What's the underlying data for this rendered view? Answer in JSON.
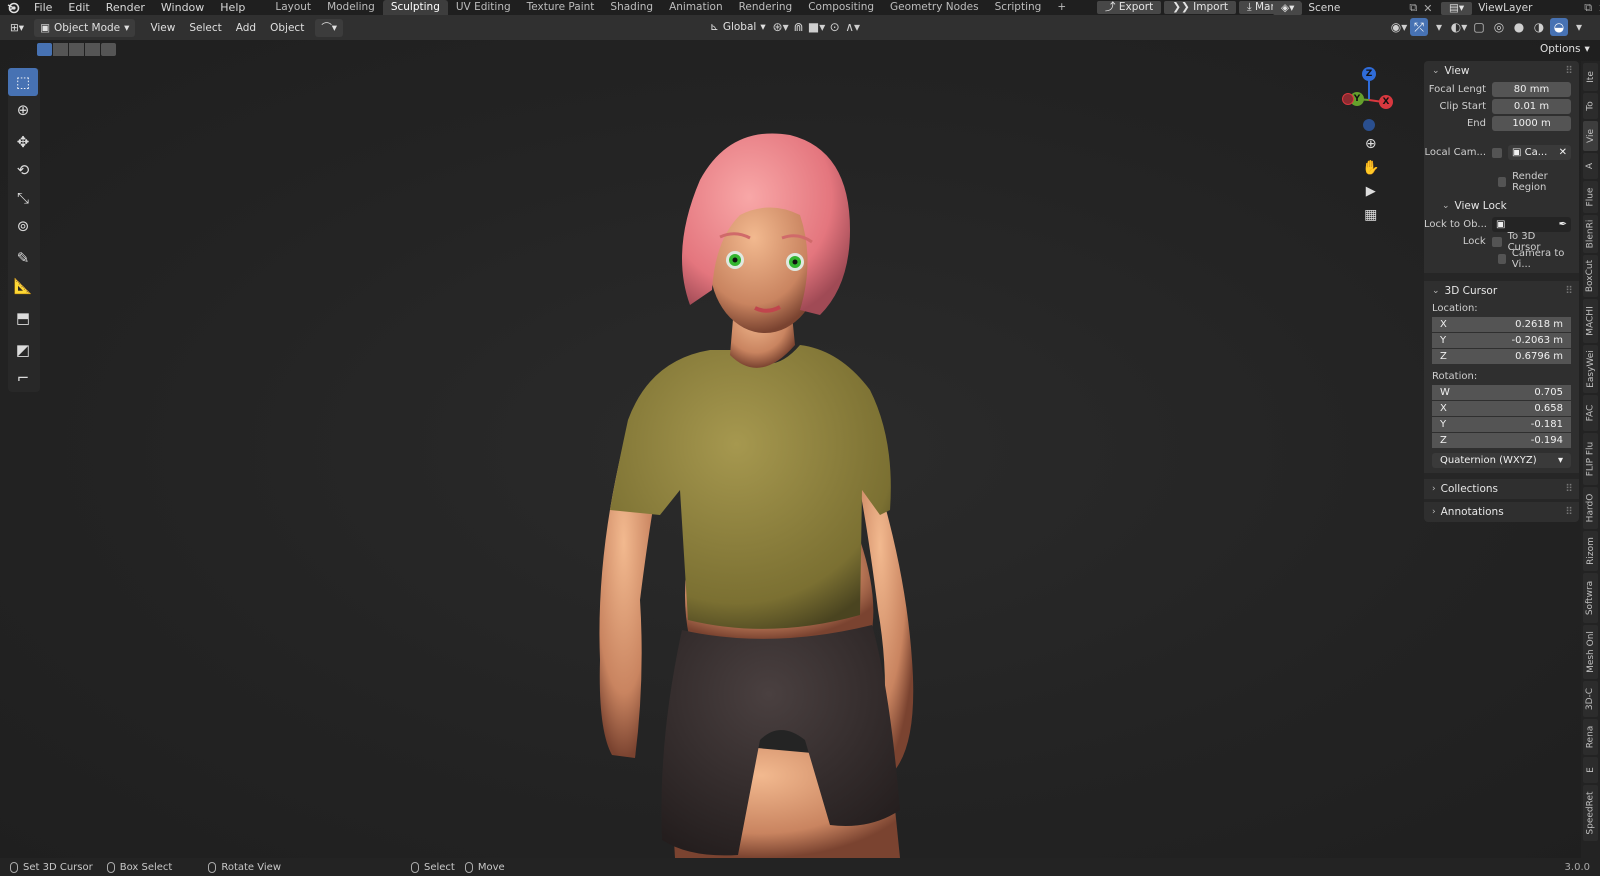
{
  "menubar": {
    "items": [
      "File",
      "Edit",
      "Render",
      "Window",
      "Help"
    ],
    "workspace_tabs": [
      "Layout",
      "Modeling",
      "Sculpting",
      "UV Editing",
      "Texture Paint",
      "Shading",
      "Animation",
      "Rendering",
      "Compositing",
      "Geometry Nodes",
      "Scripting"
    ],
    "active_tab": "Sculpting",
    "add_tab": "+",
    "export_label": "Export",
    "import_label": "Import",
    "manual_label": "Manual",
    "scene_label": "Scene",
    "viewlayer_label": "ViewLayer"
  },
  "header": {
    "mode": "Object Mode",
    "menus": [
      "View",
      "Select",
      "Add",
      "Object"
    ],
    "transform_orientation": "Global",
    "options_label": "Options"
  },
  "toolbar": {
    "tools": [
      "select-box-icon",
      "cursor-icon",
      "move-icon",
      "rotate-icon",
      "scale-icon",
      "transform-icon",
      "annotate-icon",
      "measure-icon",
      "add-cube-icon",
      "shear-icon",
      "bend-icon"
    ],
    "active": "select-box-icon"
  },
  "gizmo": {
    "z": "Z",
    "y": "Y",
    "x": "X"
  },
  "npanel": {
    "view": {
      "title": "View",
      "focal_length_label": "Focal Lengt",
      "focal_length": "80 mm",
      "clip_start_label": "Clip Start",
      "clip_start": "0.01 m",
      "end_label": "End",
      "end": "1000 m",
      "local_camera_label": "Local Cam...",
      "local_camera_value": "Ca...",
      "render_region_label": "Render Region",
      "view_lock_title": "View Lock",
      "lock_to_object_label": "Lock to Ob...",
      "lock_label": "Lock",
      "to_3d_cursor_label": "To 3D Cursor",
      "camera_to_view_label": "Camera to Vi..."
    },
    "cursor": {
      "title": "3D Cursor",
      "location_label": "Location:",
      "location": [
        {
          "axis": "X",
          "value": "0.2618 m"
        },
        {
          "axis": "Y",
          "value": "-0.2063 m"
        },
        {
          "axis": "Z",
          "value": "0.6796 m"
        }
      ],
      "rotation_label": "Rotation:",
      "rotation": [
        {
          "axis": "W",
          "value": "0.705"
        },
        {
          "axis": "X",
          "value": "0.658"
        },
        {
          "axis": "Y",
          "value": "-0.181"
        },
        {
          "axis": "Z",
          "value": "-0.194"
        }
      ],
      "rotation_mode": "Quaternion (WXYZ)"
    },
    "collections_title": "Collections",
    "annotations_title": "Annotations"
  },
  "side_tabs": [
    "Ite",
    "To",
    "Vie",
    "A",
    "Flue",
    "BlenRi",
    "BoxCut",
    "MACHI",
    "EasyWei",
    "FAC",
    "FLIP Flu",
    "HardO",
    "Rizom",
    "Softwra",
    "Mesh Onl",
    "3D-C",
    "Rena",
    "E",
    "SpeedRet"
  ],
  "statusbar": {
    "set_cursor": "Set 3D Cursor",
    "box_select": "Box Select",
    "rotate_view": "Rotate View",
    "select": "Select",
    "move": "Move",
    "version": "3.0.0"
  }
}
